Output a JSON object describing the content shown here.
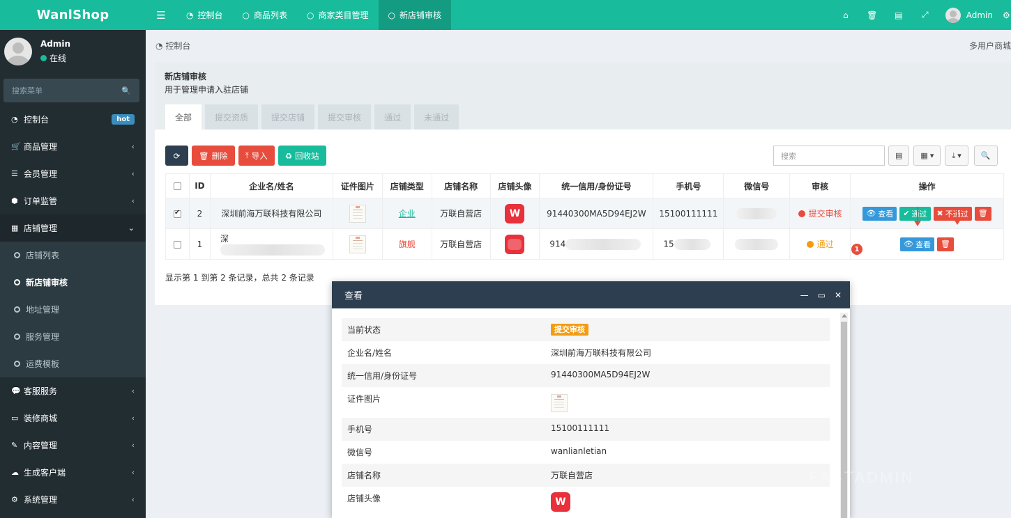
{
  "app": {
    "logo": "WanlShop"
  },
  "topbar": {
    "tabs": [
      {
        "label": "控制台",
        "icon": "dashboard-icon"
      },
      {
        "label": "商品列表",
        "icon": "circle-icon"
      },
      {
        "label": "商家类目管理",
        "icon": "circle-icon"
      },
      {
        "label": "新店铺审核",
        "icon": "circle-icon",
        "active": true
      }
    ],
    "admin_name": "Admin"
  },
  "sidebar": {
    "user_name": "Admin",
    "user_status": "在线",
    "search_placeholder": "搜索菜单",
    "items": [
      {
        "label": "控制台",
        "icon": "dashboard-icon",
        "badge": "hot"
      },
      {
        "label": "商品管理",
        "icon": "cart-icon"
      },
      {
        "label": "会员管理",
        "icon": "list-icon"
      },
      {
        "label": "订单监管",
        "icon": "cube-icon"
      },
      {
        "label": "店铺管理",
        "icon": "store-icon",
        "open": true
      },
      {
        "label": "客服服务",
        "icon": "chat-icon"
      },
      {
        "label": "装修商城",
        "icon": "monitor-icon"
      },
      {
        "label": "内容管理",
        "icon": "edit-icon"
      },
      {
        "label": "生成客户端",
        "icon": "cloud-icon"
      },
      {
        "label": "系统管理",
        "icon": "gear-icon"
      }
    ],
    "sub_items": [
      {
        "label": "店铺列表"
      },
      {
        "label": "新店铺审核",
        "active": true
      },
      {
        "label": "地址管理"
      },
      {
        "label": "服务管理"
      },
      {
        "label": "运费模板"
      }
    ]
  },
  "breadcrumb": {
    "home": "控制台",
    "right": "多用户商城"
  },
  "panel": {
    "title": "新店铺审核",
    "subtitle": "用于管理申请入驻店铺",
    "tabs": [
      "全部",
      "提交资质",
      "提交店铺",
      "提交审核",
      "通过",
      "未通过"
    ]
  },
  "toolbar": {
    "delete": "删除",
    "import": "导入",
    "recycle": "回收站",
    "search_placeholder": "搜索"
  },
  "table": {
    "headers": [
      "ID",
      "企业名/姓名",
      "证件图片",
      "店铺类型",
      "店铺名称",
      "店铺头像",
      "统一信用/身份证号",
      "手机号",
      "微信号",
      "审核",
      "操作"
    ],
    "rows": [
      {
        "id": "2",
        "name": "深圳前海万联科技有限公司",
        "type": "企业",
        "shop": "万联自营店",
        "credit": "91440300MA5D94EJ2W",
        "phone": "15100111111",
        "status": "提交审核",
        "status_color": "#e74c3c"
      },
      {
        "id": "1",
        "name": "深",
        "type": "旗舰",
        "shop": "万联自营店",
        "credit": "914",
        "phone": "15",
        "status": "通过",
        "status_color": "#f39c12"
      }
    ],
    "ops": {
      "view": "查看",
      "pass": "通过",
      "reject": "不通过"
    },
    "badge": "1",
    "page_info": "显示第 1 到第 2 条记录，总共 2 条记录"
  },
  "modal": {
    "title": "查看",
    "rows": [
      {
        "key": "当前状态",
        "value": "提交审核"
      },
      {
        "key": "企业名/姓名",
        "value": "深圳前海万联科技有限公司"
      },
      {
        "key": "统一信用/身份证号",
        "value": "91440300MA5D94EJ2W"
      },
      {
        "key": "证件图片",
        "value": ""
      },
      {
        "key": "手机号",
        "value": "15100111111"
      },
      {
        "key": "微信号",
        "value": "wanlianletian"
      },
      {
        "key": "店铺名称",
        "value": "万联自营店"
      },
      {
        "key": "店铺头像",
        "value": ""
      }
    ]
  },
  "watermark": "FASTADMIN",
  "colors": {
    "brand": "#18bc9c",
    "sidebar": "#222d32",
    "danger": "#e74c3c",
    "warning": "#f39c12",
    "info": "#3498db"
  }
}
